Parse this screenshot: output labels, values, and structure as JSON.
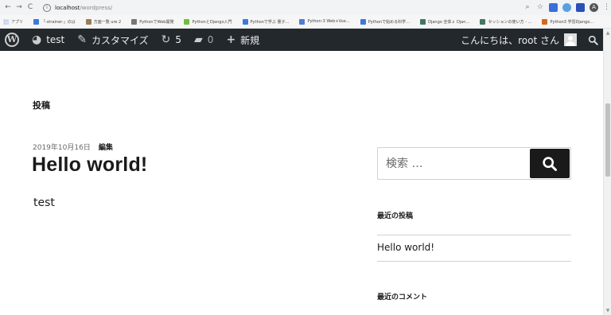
{
  "browser": {
    "url_host": "localhost",
    "url_path": "/wordpress/",
    "bookmarks": [
      {
        "label": "アプリ",
        "color": "#4a6bd8"
      },
      {
        "label": "「-strainer-」のは",
        "color": "#3b7bd6"
      },
      {
        "label": "方面一覧 ure 2",
        "color": "#9a7b5b"
      },
      {
        "label": "PythonでWeb開発",
        "color": "#777777"
      },
      {
        "label": "PythonとDjango入門",
        "color": "#6fbf3f"
      },
      {
        "label": "Pythonで学ぶ 量子…",
        "color": "#3c7bd9"
      },
      {
        "label": "Python-3 Web+Vue…",
        "color": "#4a7ed6"
      },
      {
        "label": "Pythonで始める科学…",
        "color": "#3b7bd6"
      },
      {
        "label": "Django 全体ｚ Djan…",
        "color": "#447766"
      },
      {
        "label": "セッションの使い方 - …",
        "color": "#447766"
      },
      {
        "label": "Python3 学習Django…",
        "color": "#d2691e"
      }
    ]
  },
  "adminbar": {
    "site_name": "test",
    "customize": "カスタマイズ",
    "updates_count": "5",
    "comments_count": "0",
    "new_label": "新規",
    "greeting": "こんにちは、root さん"
  },
  "content": {
    "page_title": "投稿",
    "post_date": "2019年10月16日",
    "edit_label": "編集",
    "post_title": "Hello world!",
    "post_body": "test"
  },
  "sidebar": {
    "search_placeholder": "検索 …",
    "recent_posts_title": "最近の投稿",
    "recent_posts": [
      "Hello world!"
    ],
    "recent_comments_title": "最近のコメント"
  }
}
